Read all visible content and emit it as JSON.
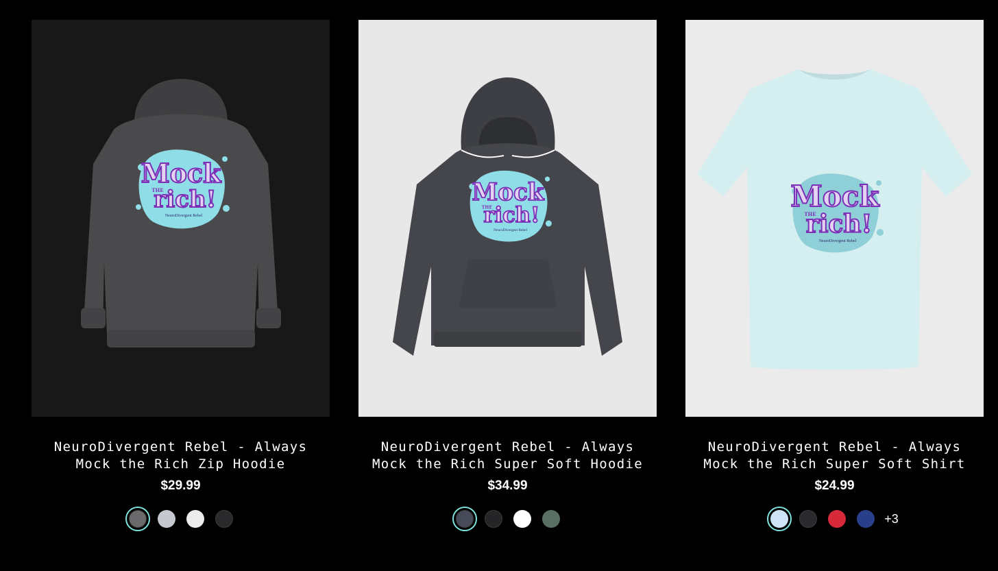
{
  "products": [
    {
      "title": "NeuroDivergent Rebel - Always Mock the Rich Zip Hoodie",
      "price": "$29.99",
      "bg": "#181818",
      "garment_color": "#4a4a4c",
      "swatches": [
        "#6a6a6c",
        "#c6c8d0",
        "#ececec",
        "#2a2a2c"
      ],
      "selected_swatch": 0,
      "more": ""
    },
    {
      "title": "NeuroDivergent Rebel - Always Mock the Rich Super Soft Hoodie",
      "price": "$34.99",
      "bg": "#e8e8e8",
      "garment_color": "#45464b",
      "swatches": [
        "#474a58",
        "#252527",
        "#ffffff",
        "#5a6f63"
      ],
      "selected_swatch": 0,
      "more": ""
    },
    {
      "title": "NeuroDivergent Rebel - Always Mock the Rich Super Soft Shirt",
      "price": "$24.99",
      "bg": "#ebebeb",
      "garment_color": "#d5eef0",
      "swatches": [
        "#cfe3f7",
        "#2a2a2e",
        "#d6293a",
        "#2a3f8a"
      ],
      "selected_swatch": 0,
      "more": "+3"
    }
  ],
  "design": {
    "line1": "Mock",
    "line2": "THE",
    "line3": "rich!",
    "credit": "NeuroDivergent Rebel",
    "splash_color": "#8fdde6",
    "text_fill": "#e3d2f2",
    "text_stroke": "#7a2fb6"
  },
  "accent": "#7fe3dd"
}
